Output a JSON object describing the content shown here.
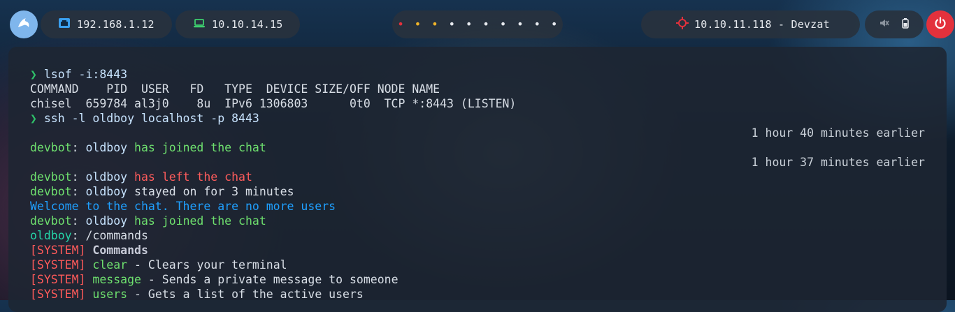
{
  "colors": {
    "logo_bg": "#7fb6ec",
    "power_bg": "#e3313c",
    "target_icon": "#e3313c",
    "local_icon": "#3aa0f0",
    "vpn_icon": "#3ecf6e",
    "prompt": "#2fc46a",
    "joined": "#6ee06e",
    "left": "#ff5c5c",
    "welcome": "#1fa0ff",
    "system": "#ff5a5a"
  },
  "topbar": {
    "logo_icon": "bird-icon",
    "local_ip": "192.168.1.12",
    "local_icon": "network-icon",
    "vpn_ip": "10.10.14.15",
    "vpn_icon": "laptop-icon",
    "workspaces": [
      {
        "glyph": "•",
        "color": "#e3313c"
      },
      {
        "glyph": "•",
        "color": "#f0b429"
      },
      {
        "glyph": "•",
        "color": "#f0b429"
      },
      {
        "glyph": "•",
        "color": "#e6e9ee"
      },
      {
        "glyph": "•",
        "color": "#e6e9ee"
      },
      {
        "glyph": "•",
        "color": "#e6e9ee"
      },
      {
        "glyph": "•",
        "color": "#e6e9ee"
      },
      {
        "glyph": "•",
        "color": "#e6e9ee"
      },
      {
        "glyph": "•",
        "color": "#e6e9ee"
      },
      {
        "glyph": "•",
        "color": "#e6e9ee"
      }
    ],
    "target": "10.10.11.118 - Devzat",
    "target_icon": "crosshair-icon",
    "tray": [
      "mute-icon",
      "battery-icon"
    ],
    "power_icon": "power-icon"
  },
  "terminal": {
    "prompt_symbol": "❯",
    "cmd1": "lsof -i:8443",
    "lsof_header": "COMMAND    PID  USER   FD   TYPE  DEVICE SIZE/OFF NODE NAME",
    "lsof_row": "chisel  659784 al3j0    8u  IPv6 1306803      0t0  TCP *:8443 (LISTEN)",
    "cmd2": "ssh -l oldboy localhost -p 8443",
    "time1": "1 hour 40 minutes earlier",
    "time2": "1 hour 37 minutes earlier",
    "devbot": "devbot",
    "colon": ":",
    "user": "oldboy",
    "joined": "has joined the chat",
    "left": "has left the chat",
    "stayed": "stayed on for 3 minutes",
    "welcome": "Welcome to the chat. There are no more users",
    "user_cmd": "/commands",
    "system_tag": "[SYSTEM]",
    "commands_title": "Commands",
    "dash": "-",
    "cmd_clear": "clear",
    "cmd_clear_desc": "Clears your terminal",
    "cmd_message": "message",
    "cmd_message_desc": "Sends a private message to someone",
    "cmd_users": "users",
    "cmd_users_desc": "Gets a list of the active users"
  }
}
